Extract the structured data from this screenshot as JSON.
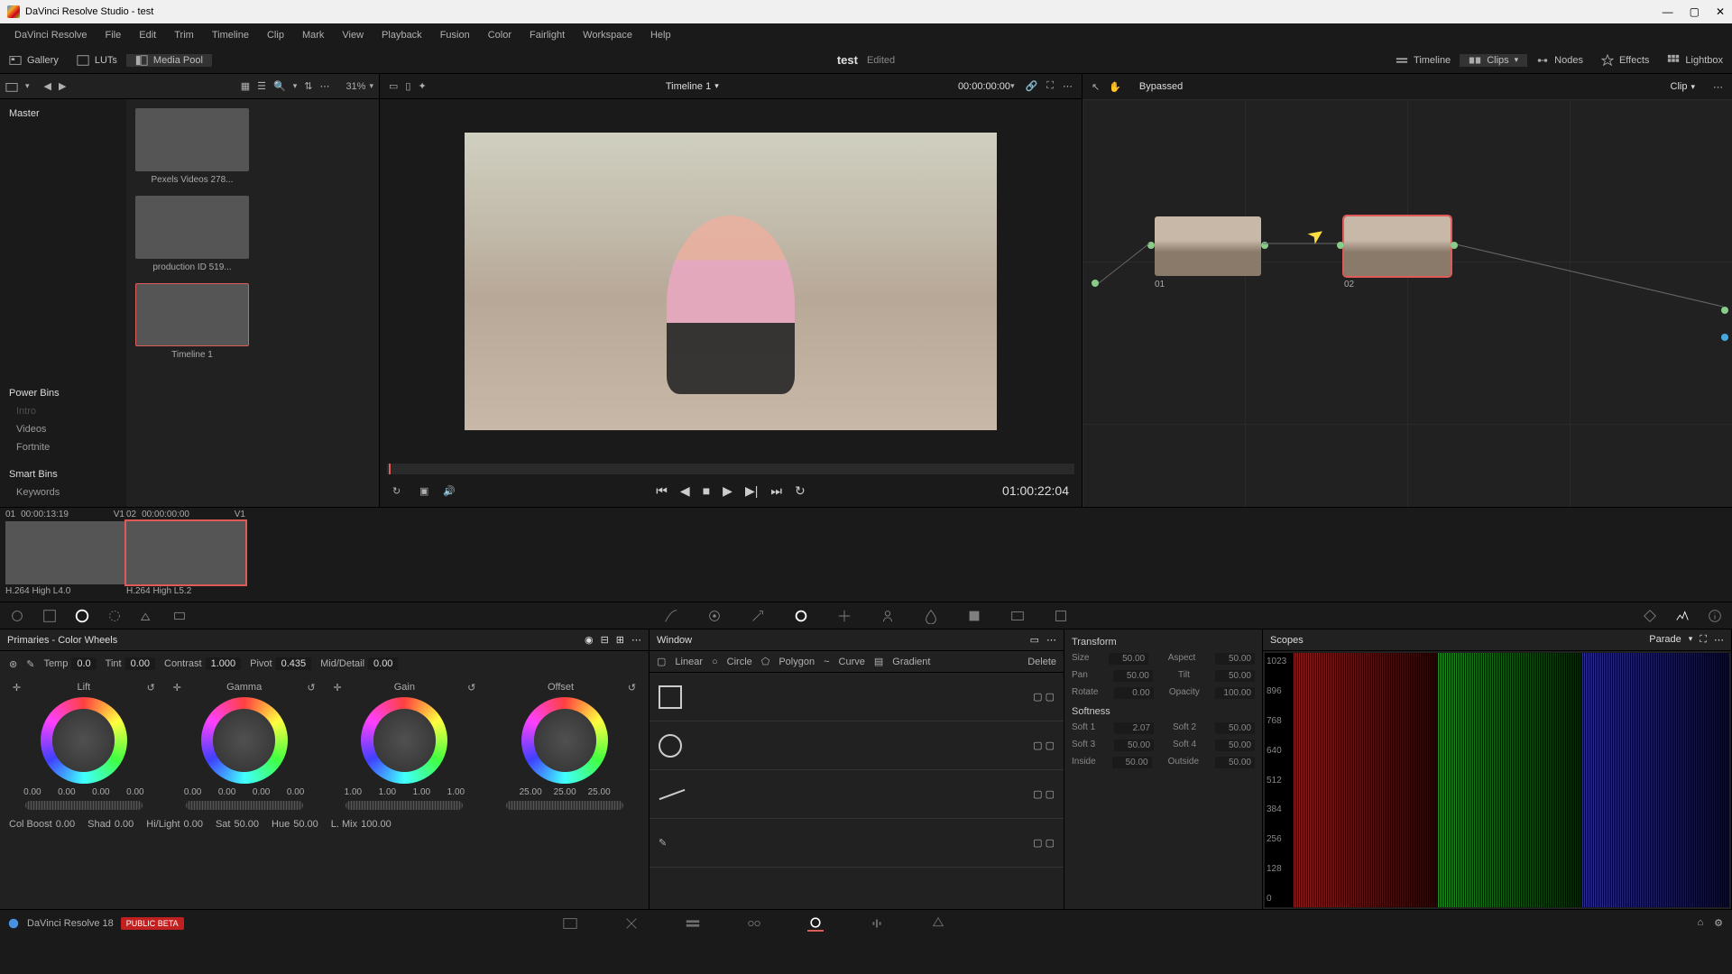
{
  "window": {
    "title": "DaVinci Resolve Studio - test"
  },
  "menu": [
    "DaVinci Resolve",
    "File",
    "Edit",
    "Trim",
    "Timeline",
    "Clip",
    "Mark",
    "View",
    "Playback",
    "Fusion",
    "Color",
    "Fairlight",
    "Workspace",
    "Help"
  ],
  "topbar": {
    "gallery": "Gallery",
    "luts": "LUTs",
    "mediapool": "Media Pool",
    "doc_name": "test",
    "edited": "Edited",
    "timeline": "Timeline",
    "clips": "Clips",
    "nodes": "Nodes",
    "effects": "Effects",
    "lightbox": "Lightbox"
  },
  "mediapool": {
    "master": "Master",
    "zoom": "31%",
    "timeline_name": "Timeline 1",
    "timecode": "00:00:00:00",
    "thumbs": [
      {
        "label": "Pexels Videos 278..."
      },
      {
        "label": "production ID 519..."
      },
      {
        "label": "Timeline 1"
      }
    ],
    "power_bins": "Power Bins",
    "power_items": [
      "Intro",
      "Videos",
      "Fortnite"
    ],
    "smart_bins": "Smart Bins",
    "smart_items": [
      "Keywords"
    ]
  },
  "viewer": {
    "duration": "01:00:22:04"
  },
  "nodes": {
    "bypassed": "Bypassed",
    "clip": "Clip",
    "n1": "01",
    "n2": "02"
  },
  "clips": [
    {
      "idx": "01",
      "tc": "00:00:13:19",
      "vtrack": "V1",
      "codec": "H.264 High L4.0"
    },
    {
      "idx": "02",
      "tc": "00:00:00:00",
      "vtrack": "V1",
      "codec": "H.264 High L5.2"
    }
  ],
  "primaries": {
    "title": "Primaries - Color Wheels",
    "temp_l": "Temp",
    "temp": "0.0",
    "tint_l": "Tint",
    "tint": "0.00",
    "contrast_l": "Contrast",
    "contrast": "1.000",
    "pivot_l": "Pivot",
    "pivot": "0.435",
    "md_l": "Mid/Detail",
    "md": "0.00",
    "lift": "Lift",
    "gamma": "Gamma",
    "gain": "Gain",
    "offset": "Offset",
    "lift_v": [
      "0.00",
      "0.00",
      "0.00",
      "0.00"
    ],
    "gamma_v": [
      "0.00",
      "0.00",
      "0.00",
      "0.00"
    ],
    "gain_v": [
      "1.00",
      "1.00",
      "1.00",
      "1.00"
    ],
    "offset_v": [
      "25.00",
      "25.00",
      "25.00"
    ],
    "cb_l": "Col Boost",
    "cb": "0.00",
    "shad_l": "Shad",
    "shad": "0.00",
    "hl_l": "Hi/Light",
    "hl": "0.00",
    "sat_l": "Sat",
    "sat": "50.00",
    "hue_l": "Hue",
    "hue": "50.00",
    "lmix_l": "L. Mix",
    "lmix": "100.00"
  },
  "window_panel": {
    "title": "Window",
    "tools": [
      "Linear",
      "Circle",
      "Polygon",
      "Curve",
      "Gradient",
      "Delete"
    ]
  },
  "xform": {
    "title": "Transform",
    "size_l": "Size",
    "size": "50.00",
    "aspect_l": "Aspect",
    "aspect": "50.00",
    "pan_l": "Pan",
    "pan": "50.00",
    "tilt_l": "Tilt",
    "tilt": "50.00",
    "rotate_l": "Rotate",
    "rotate": "0.00",
    "opacity_l": "Opacity",
    "opacity": "100.00",
    "softness": "Softness",
    "s1_l": "Soft 1",
    "s1": "2.07",
    "s2_l": "Soft 2",
    "s2": "50.00",
    "s3_l": "Soft 3",
    "s3": "50.00",
    "s4_l": "Soft 4",
    "s4": "50.00",
    "in_l": "Inside",
    "in": "50.00",
    "out_l": "Outside",
    "out": "50.00"
  },
  "scopes": {
    "title": "Scopes",
    "mode": "Parade",
    "ticks": [
      "1023",
      "896",
      "768",
      "640",
      "512",
      "384",
      "256",
      "128",
      "0"
    ]
  },
  "bottom": {
    "version": "DaVinci Resolve 18",
    "badge": "PUBLIC BETA"
  }
}
